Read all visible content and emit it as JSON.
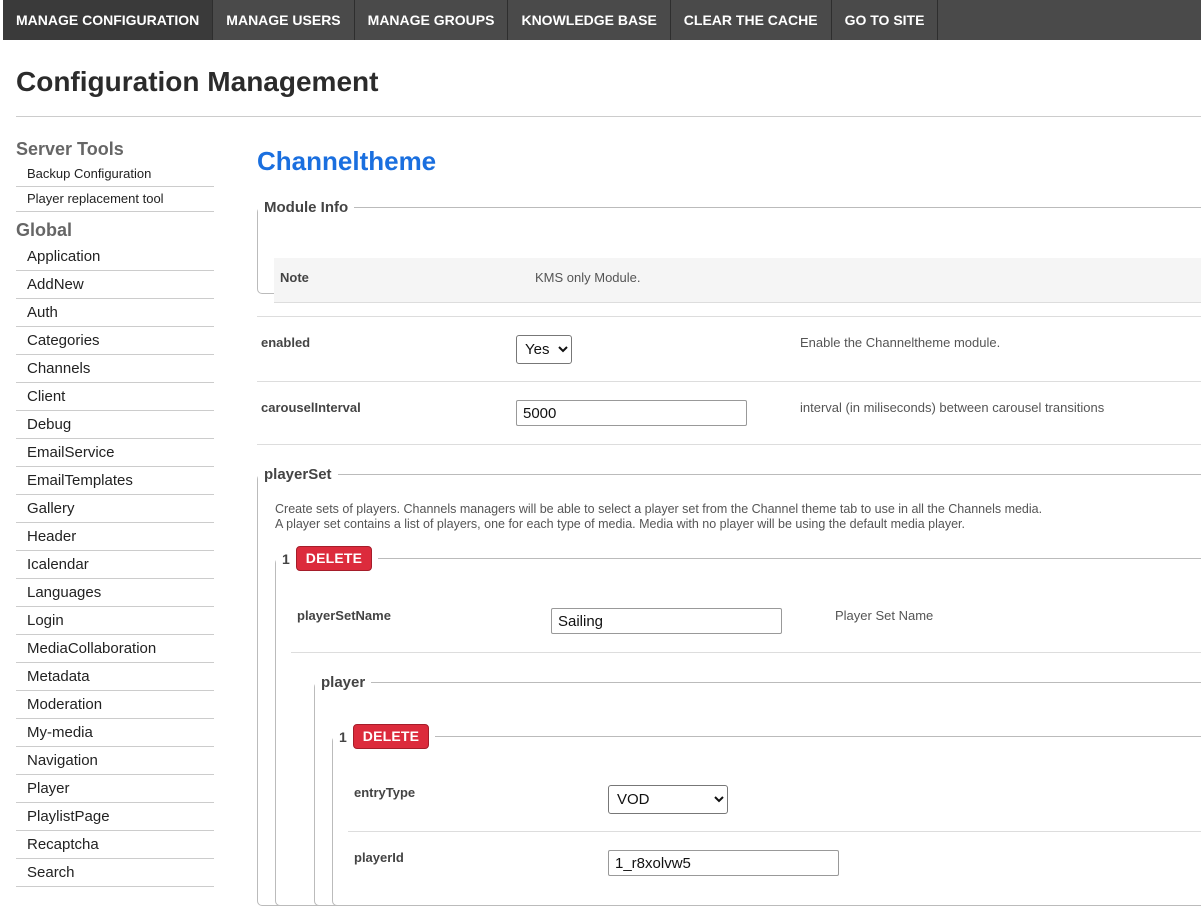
{
  "nav": {
    "items": [
      "MANAGE CONFIGURATION",
      "MANAGE USERS",
      "MANAGE GROUPS",
      "KNOWLEDGE BASE",
      "CLEAR THE CACHE",
      "GO TO SITE"
    ]
  },
  "page": {
    "title": "Configuration Management"
  },
  "sidebar": {
    "server_tools_heading": "Server Tools",
    "server_tools": [
      "Backup Configuration",
      "Player replacement tool"
    ],
    "global_heading": "Global",
    "global": [
      "Application",
      "AddNew",
      "Auth",
      "Categories",
      "Channels",
      "Client",
      "Debug",
      "EmailService",
      "EmailTemplates",
      "Gallery",
      "Header",
      "Icalendar",
      "Languages",
      "Login",
      "MediaCollaboration",
      "Metadata",
      "Moderation",
      "My-media",
      "Navigation",
      "Player",
      "PlaylistPage",
      "Recaptcha",
      "Search"
    ]
  },
  "module": {
    "title": "Channeltheme",
    "info_legend": "Module Info",
    "note_label": "Note",
    "note_value": "KMS only Module.",
    "enabled": {
      "label": "enabled",
      "value": "Yes",
      "description": "Enable the Channeltheme module."
    },
    "carousel": {
      "label": "carouselInterval",
      "value": "5000",
      "description": "interval (in miliseconds) between carousel transitions"
    },
    "player_set": {
      "legend": "playerSet",
      "description_line1": "Create sets of players. Channels managers will be able to select a player set from the Channel theme tab to use in all the Channels media.",
      "description_line2": "A player set contains a list of players, one for each type of media. Media with no player will be using the default media player.",
      "item_number": "1",
      "delete_label": "DELETE",
      "name_label": "playerSetName",
      "name_value": "Sailing",
      "name_description": "Player Set Name",
      "player_legend": "player",
      "player_item_number": "1",
      "player_delete_label": "DELETE",
      "entry_type_label": "entryType",
      "entry_type_value": "VOD",
      "player_id_label": "playerId",
      "player_id_value": "1_r8xolvw5"
    }
  }
}
